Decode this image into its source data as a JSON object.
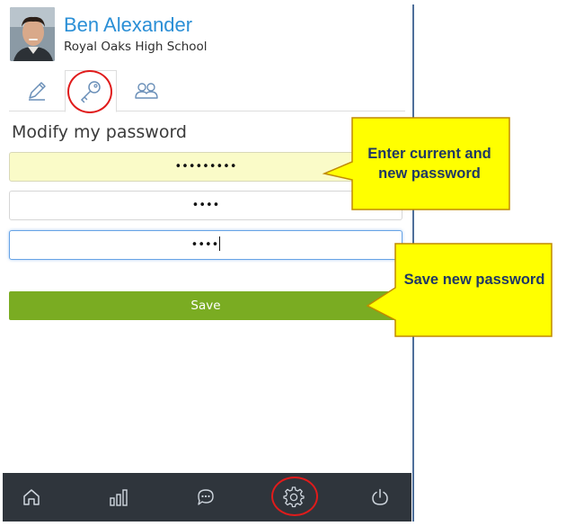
{
  "profile": {
    "name": "Ben Alexander",
    "school": "Royal Oaks High School",
    "avatar_icon": "person-photo"
  },
  "tabs": [
    {
      "id": "edit",
      "icon": "pencil-icon",
      "selected": false
    },
    {
      "id": "password",
      "icon": "key-icon",
      "selected": true
    },
    {
      "id": "groups",
      "icon": "users-icon",
      "selected": false
    }
  ],
  "form": {
    "title": "Modify my password",
    "current_password": "•••••••••",
    "new_password": "••••",
    "confirm_password": "••••",
    "save_label": "Save"
  },
  "bottom_nav": [
    {
      "id": "home",
      "icon": "home-icon"
    },
    {
      "id": "stats",
      "icon": "bar-chart-icon"
    },
    {
      "id": "messages",
      "icon": "chat-bubble-icon"
    },
    {
      "id": "settings",
      "icon": "gear-icon",
      "selected": true
    },
    {
      "id": "logout",
      "icon": "power-icon"
    }
  ],
  "callouts": {
    "passwords": "Enter current and new password",
    "save": "Save new password"
  },
  "colors": {
    "accent_blue": "#2b8fd6",
    "save_green": "#7aac22",
    "nav_dark": "#2f353c",
    "highlight_yellow": "#fafbc8",
    "callout_yellow": "#ffff00",
    "annotation_red": "#e01b1b"
  }
}
